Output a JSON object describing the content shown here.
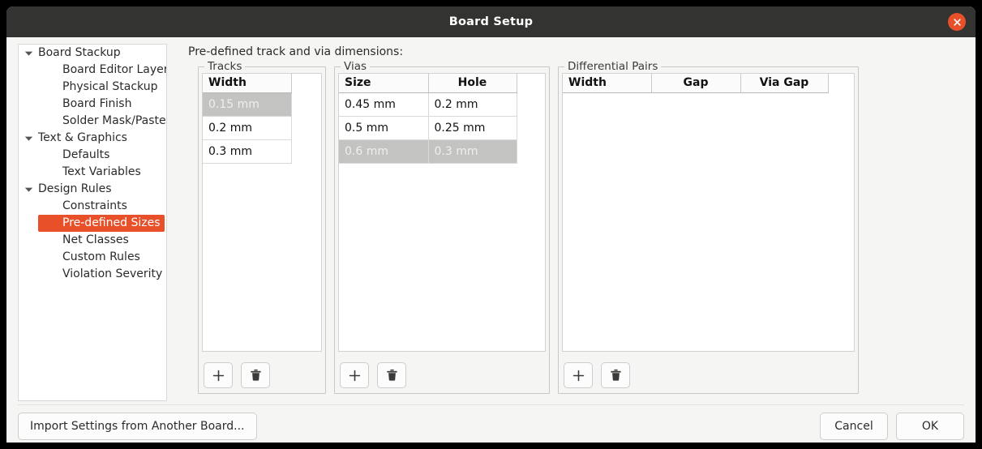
{
  "window": {
    "title": "Board Setup",
    "close_icon": "close-icon"
  },
  "sidebar": {
    "items": [
      {
        "label": "Board Stackup",
        "level": "root",
        "expanded": true,
        "selected": false
      },
      {
        "label": "Board Editor Layers",
        "level": "child",
        "expanded": false,
        "selected": false
      },
      {
        "label": "Physical Stackup",
        "level": "child",
        "expanded": false,
        "selected": false
      },
      {
        "label": "Board Finish",
        "level": "child",
        "expanded": false,
        "selected": false
      },
      {
        "label": "Solder Mask/Paste",
        "level": "child",
        "expanded": false,
        "selected": false
      },
      {
        "label": "Text & Graphics",
        "level": "root",
        "expanded": true,
        "selected": false
      },
      {
        "label": "Defaults",
        "level": "child",
        "expanded": false,
        "selected": false
      },
      {
        "label": "Text Variables",
        "level": "child",
        "expanded": false,
        "selected": false
      },
      {
        "label": "Design Rules",
        "level": "root",
        "expanded": true,
        "selected": false
      },
      {
        "label": "Constraints",
        "level": "child",
        "expanded": false,
        "selected": false
      },
      {
        "label": "Pre-defined Sizes",
        "level": "child",
        "expanded": false,
        "selected": true
      },
      {
        "label": "Net Classes",
        "level": "child",
        "expanded": false,
        "selected": false
      },
      {
        "label": "Custom Rules",
        "level": "child",
        "expanded": false,
        "selected": false
      },
      {
        "label": "Violation Severity",
        "level": "child",
        "expanded": false,
        "selected": false
      }
    ]
  },
  "pane": {
    "caption": "Pre-defined track and via dimensions:",
    "tracks": {
      "title": "Tracks",
      "columns": [
        {
          "label": "Width",
          "align": "al"
        }
      ],
      "rows": [
        {
          "cells": [
            "0.15 mm"
          ],
          "selected": true
        },
        {
          "cells": [
            "0.2 mm"
          ],
          "selected": false
        },
        {
          "cells": [
            "0.3 mm"
          ],
          "selected": false
        }
      ],
      "add_icon": "plus-icon",
      "delete_icon": "trash-icon"
    },
    "vias": {
      "title": "Vias",
      "columns": [
        {
          "label": "Size",
          "align": "al"
        },
        {
          "label": "Hole",
          "align": "ac"
        }
      ],
      "rows": [
        {
          "cells": [
            "0.45 mm",
            "0.2 mm"
          ],
          "selected": false
        },
        {
          "cells": [
            "0.5 mm",
            "0.25 mm"
          ],
          "selected": false
        },
        {
          "cells": [
            "0.6 mm",
            "0.3 mm"
          ],
          "selected": true
        }
      ],
      "add_icon": "plus-icon",
      "delete_icon": "trash-icon"
    },
    "differential_pairs": {
      "title": "Differential Pairs",
      "columns": [
        {
          "label": "Width",
          "align": "al"
        },
        {
          "label": "Gap",
          "align": "ac"
        },
        {
          "label": "Via Gap",
          "align": "ac"
        }
      ],
      "rows": [],
      "add_icon": "plus-icon",
      "delete_icon": "trash-icon"
    }
  },
  "footer": {
    "import_label": "Import Settings from Another Board...",
    "cancel_label": "Cancel",
    "ok_label": "OK"
  },
  "colors": {
    "titlebar": "#333331",
    "close_button": "#e8502a",
    "selection_accent": "#e8502a",
    "grid_selection": "#c3c3c1",
    "window_background": "#f5f5f4"
  }
}
